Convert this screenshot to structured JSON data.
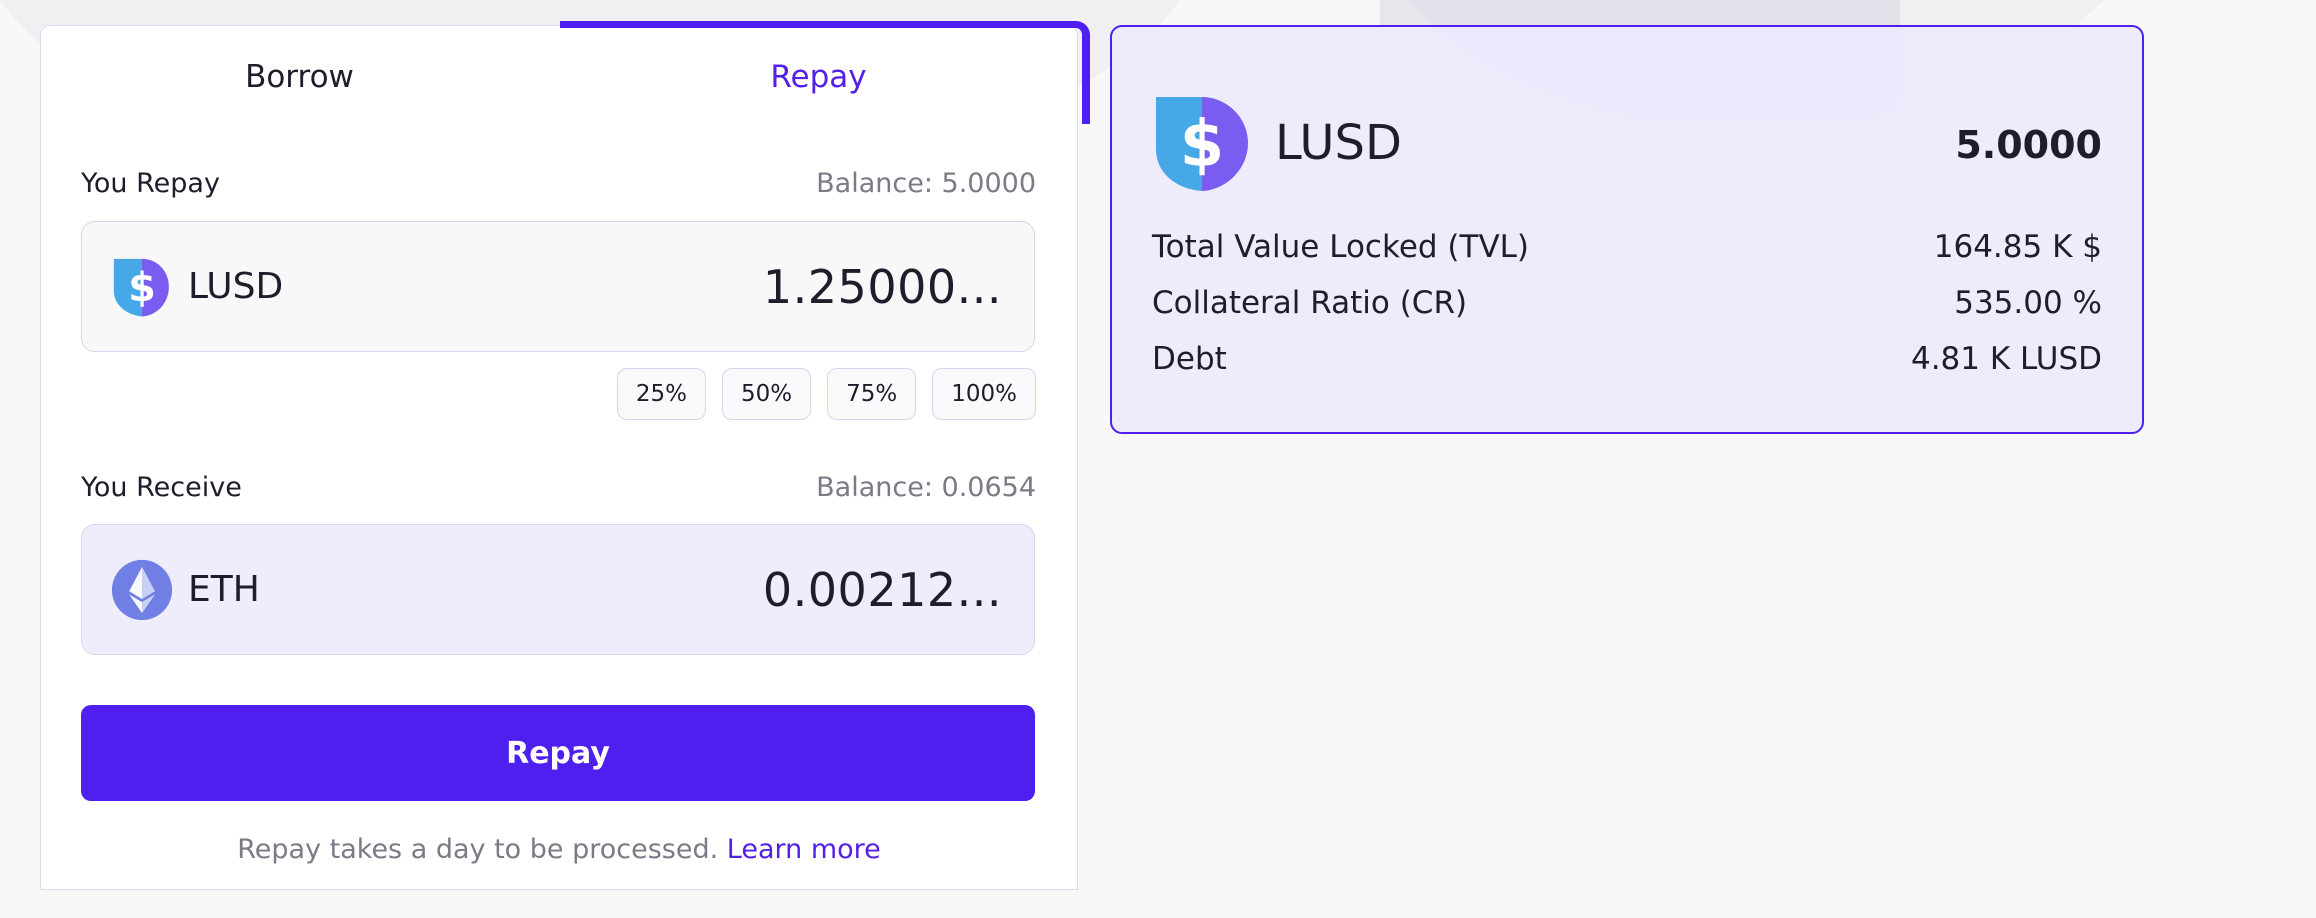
{
  "tabs": [
    {
      "label": "Borrow",
      "active": false
    },
    {
      "label": "Repay",
      "active": true
    }
  ],
  "repay_section": {
    "label": "You Repay",
    "balance": "Balance: 5.0000",
    "token": {
      "name": "LUSD",
      "icon": "lusd-icon"
    },
    "amount": "1.25000..."
  },
  "percent_buttons": [
    "25%",
    "50%",
    "75%",
    "100%"
  ],
  "receive_section": {
    "label": "You Receive",
    "balance": "Balance: 0.0654",
    "token": {
      "name": "ETH",
      "icon": "eth-icon"
    },
    "amount": "0.00212..."
  },
  "action": {
    "button_label": "Repay",
    "note": "Repay takes a day to be processed.",
    "learn_more": "Learn more"
  },
  "summary_card": {
    "token": "LUSD",
    "icon": "lusd-icon",
    "balance": "5.0000",
    "stats": [
      {
        "label": "Total Value Locked (TVL)",
        "value": "164.85 K $"
      },
      {
        "label": "Collateral Ratio (CR)",
        "value": "535.00 %"
      },
      {
        "label": "Debt",
        "value": "4.81 K LUSD"
      }
    ]
  },
  "colors": {
    "accent": "#4f1ff0",
    "tab_active_text": "#5420e8",
    "muted_text": "#7b7a86",
    "card_bg": "#ece9fc"
  }
}
